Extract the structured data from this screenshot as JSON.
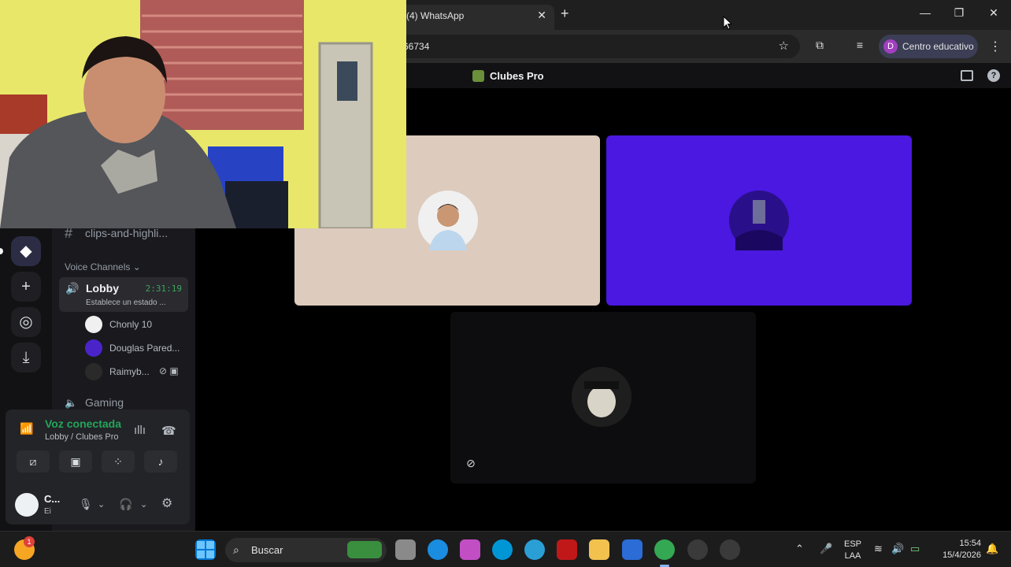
{
  "browser": {
    "tab_title": "(4) WhatsApp",
    "tab_close": "✕",
    "new_tab": "+",
    "url": "66734",
    "profile_initial": "D",
    "profile_name": "Centro educativo",
    "window_controls": [
      "—",
      "❐",
      "✕"
    ]
  },
  "discord": {
    "server_name": "Clubes Pro",
    "channels": {
      "text_channel": "clips-and-highli...",
      "category": "Voice Channels",
      "lobby": {
        "name": "Lobby",
        "timer": "2:31:19",
        "status": "Establece un estado ..."
      },
      "members": [
        {
          "name": "Chonly 10",
          "color": "#f0f0f0"
        },
        {
          "name": "Douglas Pared...",
          "color": "#4a24c9"
        },
        {
          "name": "Raimyb...",
          "color": "#2a2a2a"
        }
      ],
      "gaming": "Gaming"
    },
    "voice_panel": {
      "title": "Voz conectada",
      "subtitle": "Lobby / Clubes Pro"
    },
    "user": {
      "name": "C...",
      "status": "Ei"
    },
    "tiles": [
      {
        "background": "#ddcbbd",
        "avatar_color": "#f0f0f0"
      },
      {
        "background": "#4a18e0",
        "avatar_color": "#3a1aa8"
      },
      {
        "background": "#0d0d0f",
        "avatar_color": "#2a2a2a"
      }
    ]
  },
  "taskbar": {
    "search_placeholder": "Buscar",
    "notification_count": "1",
    "lang_top": "ESP",
    "lang_bottom": "LAA",
    "time": "15:54",
    "date": "15/4/2026"
  }
}
